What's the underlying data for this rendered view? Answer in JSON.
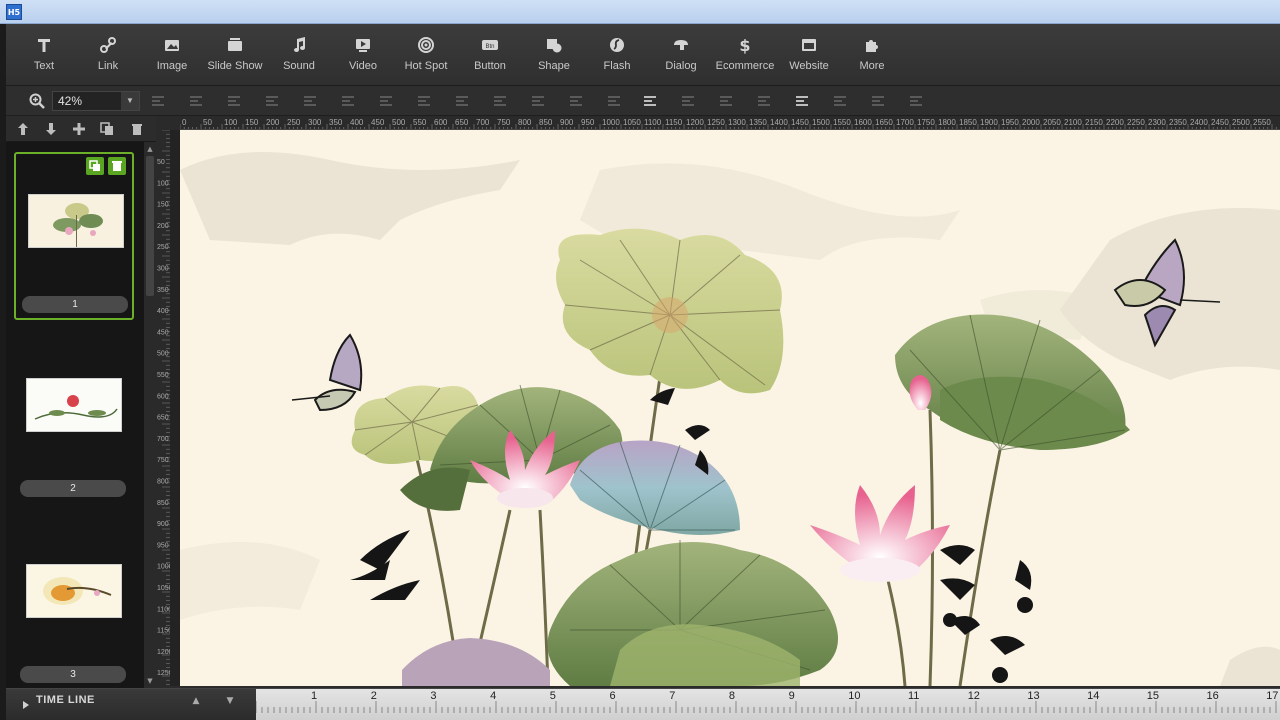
{
  "app": {
    "icon_text": "H5"
  },
  "toolbar": {
    "items": [
      {
        "label": "Text",
        "icon": "text-icon"
      },
      {
        "label": "Link",
        "icon": "link-icon"
      },
      {
        "label": "Image",
        "icon": "image-icon"
      },
      {
        "label": "Slide Show",
        "icon": "slideshow-icon"
      },
      {
        "label": "Sound",
        "icon": "music-note-icon"
      },
      {
        "label": "Video",
        "icon": "video-icon"
      },
      {
        "label": "Hot Spot",
        "icon": "hotspot-icon"
      },
      {
        "label": "Button",
        "icon": "button-icon"
      },
      {
        "label": "Shape",
        "icon": "shape-icon"
      },
      {
        "label": "Flash",
        "icon": "flash-icon"
      },
      {
        "label": "Dialog",
        "icon": "dialog-icon"
      },
      {
        "label": "Ecommerce",
        "icon": "dollar-icon"
      },
      {
        "label": "Website",
        "icon": "website-icon"
      },
      {
        "label": "More",
        "icon": "puzzle-icon"
      }
    ]
  },
  "zoom": {
    "value": "42%"
  },
  "pages": {
    "items": [
      {
        "label": "1",
        "selected": true
      },
      {
        "label": "2",
        "selected": false
      },
      {
        "label": "3",
        "selected": false
      }
    ]
  },
  "ruler": {
    "top": [
      "0",
      "50",
      "100",
      "150",
      "200",
      "250",
      "300",
      "350",
      "400",
      "450",
      "500",
      "550",
      "600",
      "650",
      "700",
      "750",
      "800",
      "850",
      "900",
      "950",
      "1000",
      "1050",
      "1100",
      "1150",
      "1200",
      "1250",
      "1300",
      "1350",
      "1400",
      "1450",
      "1500",
      "1550",
      "1600",
      "1650",
      "1700",
      "1750",
      "1800",
      "1850",
      "1900",
      "1950",
      "2000",
      "2050",
      "2100",
      "2150",
      "2200",
      "2250",
      "2300",
      "2350",
      "2400",
      "2450",
      "2500",
      "2550"
    ],
    "left": [
      "50",
      "100",
      "150",
      "200",
      "250",
      "300",
      "350",
      "400",
      "450",
      "500",
      "550",
      "600",
      "650",
      "700",
      "750",
      "800",
      "850",
      "900",
      "950",
      "1000",
      "1050",
      "1100",
      "1150",
      "1200",
      "1250"
    ]
  },
  "timeline": {
    "title": "TIME LINE",
    "numbers": [
      "1",
      "2",
      "3",
      "4",
      "5",
      "6",
      "7",
      "8",
      "9",
      "10",
      "11",
      "12",
      "13",
      "14",
      "15",
      "16",
      "17"
    ]
  },
  "colors": {
    "accent": "#6cb02a",
    "canvas_bg": "#fbf4e4"
  }
}
